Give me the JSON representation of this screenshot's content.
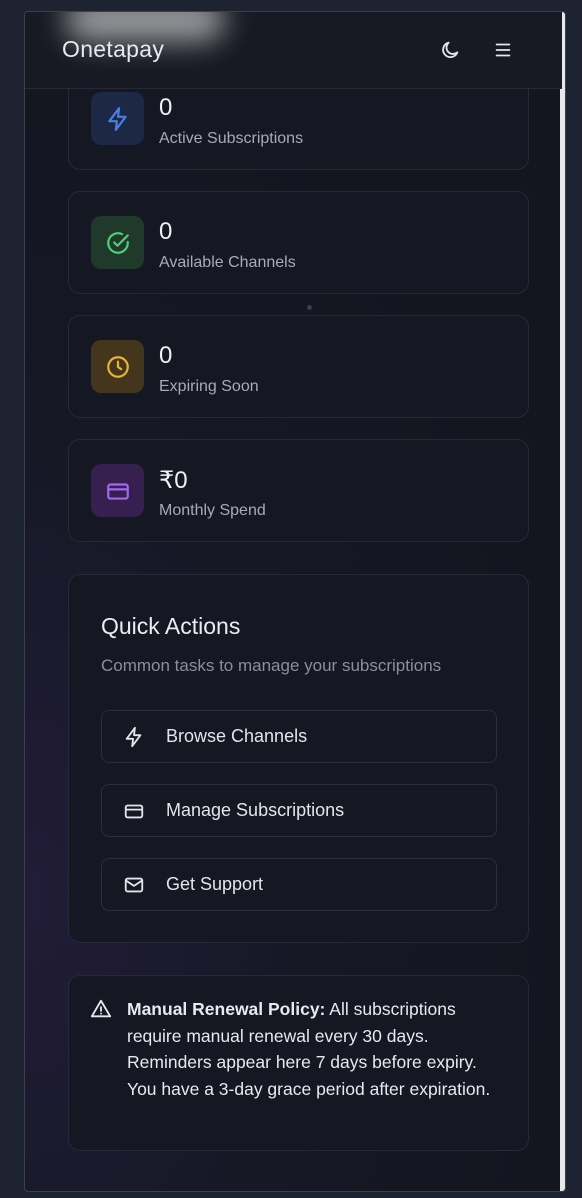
{
  "header": {
    "brand": "Onetapay",
    "theme_toggle_icon": "moon-icon",
    "menu_icon": "menu-icon"
  },
  "stats": [
    {
      "value": "0",
      "label": "Active Subscriptions",
      "icon": "lightning-icon",
      "color": "#4a7fe6"
    },
    {
      "value": "0",
      "label": "Available Channels",
      "icon": "check-circle-icon",
      "color": "#4fcf74"
    },
    {
      "value": "0",
      "label": "Expiring Soon",
      "icon": "clock-icon",
      "color": "#e9b534"
    },
    {
      "value": "₹0",
      "label": "Monthly Spend",
      "icon": "credit-card-icon",
      "color": "#a766f0"
    }
  ],
  "quick_actions": {
    "title": "Quick Actions",
    "subtitle": "Common tasks to manage your subscriptions",
    "buttons": [
      {
        "label": "Browse Channels",
        "icon": "lightning-icon"
      },
      {
        "label": "Manage Subscriptions",
        "icon": "credit-card-icon"
      },
      {
        "label": "Get Support",
        "icon": "mail-icon"
      }
    ]
  },
  "notice": {
    "title": "Manual Renewal Policy:",
    "body": " All subscriptions require manual renewal every 30 days. Reminders appear here 7 days before expiry. You have a 3-day grace period after expiration.",
    "icon": "warning-icon"
  }
}
